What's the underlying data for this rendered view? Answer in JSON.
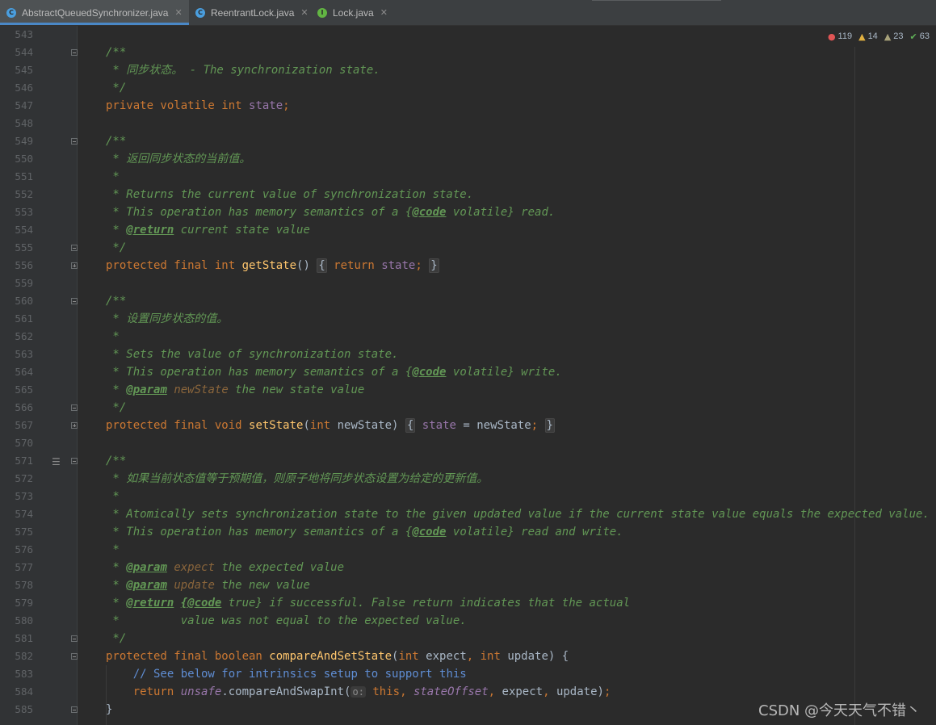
{
  "tabs": [
    {
      "label": "AbstractQueuedSynchronizer.java",
      "icon": "C",
      "icon_color": "#4a9ede",
      "active": true
    },
    {
      "label": "ReentrantLock.java",
      "icon": "C",
      "icon_color": "#4a9ede",
      "active": false
    },
    {
      "label": "Lock.java",
      "icon": "I",
      "icon_color": "#62b543",
      "active": false
    }
  ],
  "inspections": {
    "errors": "119",
    "warnings": "14",
    "weak_warnings": "23",
    "typos": "63",
    "colors": {
      "error": "#e05555",
      "warning": "#e0b040",
      "weak": "#a8a27a",
      "ok": "#5fb057"
    }
  },
  "watermark": "CSDN @今天天气不错丶",
  "lines": [
    {
      "n": "543",
      "tokens": []
    },
    {
      "n": "544",
      "fold": "open",
      "tokens": [
        [
          "doc",
          "/**"
        ]
      ]
    },
    {
      "n": "545",
      "tokens": [
        [
          "doc",
          " * 同步状态。 - The synchronization state."
        ]
      ]
    },
    {
      "n": "546",
      "tokens": [
        [
          "doc",
          " */"
        ]
      ]
    },
    {
      "n": "547",
      "tokens": [
        [
          "kw",
          "private volatile int "
        ],
        [
          "field",
          "state"
        ],
        [
          "kw",
          ";"
        ]
      ]
    },
    {
      "n": "548",
      "tokens": []
    },
    {
      "n": "549",
      "fold": "open",
      "tokens": [
        [
          "doc",
          "/**"
        ]
      ]
    },
    {
      "n": "550",
      "tokens": [
        [
          "doc",
          " * 返回同步状态的当前值。"
        ]
      ]
    },
    {
      "n": "551",
      "tokens": [
        [
          "doc",
          " *"
        ]
      ]
    },
    {
      "n": "552",
      "tokens": [
        [
          "doc",
          " * Returns the current value of synchronization state."
        ]
      ]
    },
    {
      "n": "553",
      "tokens": [
        [
          "doc",
          " * This operation has memory semantics of a "
        ],
        [
          "doc",
          "{"
        ],
        [
          "tag",
          "@code"
        ],
        [
          "doc",
          " volatile} read."
        ]
      ]
    },
    {
      "n": "554",
      "tokens": [
        [
          "doc",
          " * "
        ],
        [
          "tag",
          "@return"
        ],
        [
          "doc",
          " current state value"
        ]
      ]
    },
    {
      "n": "555",
      "fold": "open",
      "tokens": [
        [
          "doc",
          " */"
        ]
      ]
    },
    {
      "n": "556",
      "fold": "collapsed",
      "tokens": [
        [
          "kw",
          "protected final int "
        ],
        [
          "method",
          "getState"
        ],
        [
          "plain",
          "() "
        ],
        [
          "fold",
          "{"
        ],
        [
          "kw",
          " return "
        ],
        [
          "field",
          "state"
        ],
        [
          "kw",
          ";"
        ],
        [
          "plain",
          " "
        ],
        [
          "fold",
          "}"
        ]
      ]
    },
    {
      "n": "559",
      "tokens": []
    },
    {
      "n": "560",
      "fold": "open",
      "tokens": [
        [
          "doc",
          "/**"
        ]
      ]
    },
    {
      "n": "561",
      "tokens": [
        [
          "doc",
          " * 设置同步状态的值。"
        ]
      ]
    },
    {
      "n": "562",
      "tokens": [
        [
          "doc",
          " *"
        ]
      ]
    },
    {
      "n": "563",
      "tokens": [
        [
          "doc",
          " * Sets the value of synchronization state."
        ]
      ]
    },
    {
      "n": "564",
      "tokens": [
        [
          "doc",
          " * This operation has memory semantics of a "
        ],
        [
          "doc",
          "{"
        ],
        [
          "tag",
          "@code"
        ],
        [
          "doc",
          " volatile} write."
        ]
      ]
    },
    {
      "n": "565",
      "tokens": [
        [
          "doc",
          " * "
        ],
        [
          "tag",
          "@param"
        ],
        [
          "doc",
          " "
        ],
        [
          "param",
          "newState"
        ],
        [
          "doc",
          " the new state value"
        ]
      ]
    },
    {
      "n": "566",
      "fold": "open",
      "tokens": [
        [
          "doc",
          " */"
        ]
      ]
    },
    {
      "n": "567",
      "fold": "collapsed",
      "tokens": [
        [
          "kw",
          "protected final void "
        ],
        [
          "method",
          "setState"
        ],
        [
          "plain",
          "("
        ],
        [
          "kw",
          "int "
        ],
        [
          "plain",
          "newState) "
        ],
        [
          "fold",
          "{"
        ],
        [
          "plain",
          " "
        ],
        [
          "field",
          "state"
        ],
        [
          "plain",
          " = newState"
        ],
        [
          "kw",
          ";"
        ],
        [
          "plain",
          " "
        ],
        [
          "fold",
          "}"
        ]
      ]
    },
    {
      "n": "570",
      "tokens": []
    },
    {
      "n": "571",
      "fold": "open",
      "marker": true,
      "tokens": [
        [
          "doc",
          "/**"
        ]
      ]
    },
    {
      "n": "572",
      "tokens": [
        [
          "doc",
          " * 如果当前状态值等于预期值，则原子地将同步状态设置为给定的更新值。"
        ]
      ]
    },
    {
      "n": "573",
      "tokens": [
        [
          "doc",
          " *"
        ]
      ]
    },
    {
      "n": "574",
      "tokens": [
        [
          "doc",
          " * Atomically sets synchronization state to the given updated value if the current state value equals the expected value."
        ]
      ]
    },
    {
      "n": "575",
      "tokens": [
        [
          "doc",
          " * This operation has memory semantics of a "
        ],
        [
          "doc",
          "{"
        ],
        [
          "tag",
          "@code"
        ],
        [
          "doc",
          " volatile} read and write."
        ]
      ]
    },
    {
      "n": "576",
      "tokens": [
        [
          "doc",
          " *"
        ]
      ]
    },
    {
      "n": "577",
      "tokens": [
        [
          "doc",
          " * "
        ],
        [
          "tag",
          "@param"
        ],
        [
          "doc",
          " "
        ],
        [
          "param",
          "expect"
        ],
        [
          "doc",
          " the expected value"
        ]
      ]
    },
    {
      "n": "578",
      "tokens": [
        [
          "doc",
          " * "
        ],
        [
          "tag",
          "@param"
        ],
        [
          "doc",
          " "
        ],
        [
          "param",
          "update"
        ],
        [
          "doc",
          " the new value"
        ]
      ]
    },
    {
      "n": "579",
      "tokens": [
        [
          "doc",
          " * "
        ],
        [
          "tag",
          "@return"
        ],
        [
          "doc",
          " "
        ],
        [
          "tag",
          "{@code"
        ],
        [
          "doc",
          " true} if successful. False return indicates that the actual"
        ]
      ]
    },
    {
      "n": "580",
      "tokens": [
        [
          "doc",
          " *         value was not equal to the expected value."
        ]
      ]
    },
    {
      "n": "581",
      "fold": "open",
      "tokens": [
        [
          "doc",
          " */"
        ]
      ]
    },
    {
      "n": "582",
      "fold": "open",
      "tokens": [
        [
          "kw",
          "protected final boolean "
        ],
        [
          "method",
          "compareAndSetState"
        ],
        [
          "plain",
          "("
        ],
        [
          "kw",
          "int "
        ],
        [
          "plain",
          "expect"
        ],
        [
          "kw",
          ", int "
        ],
        [
          "plain",
          "update) {"
        ]
      ]
    },
    {
      "n": "583",
      "tokens": [
        [
          "plain",
          "    "
        ],
        [
          "cmt",
          "// See below for intrinsics setup to support this"
        ]
      ]
    },
    {
      "n": "584",
      "tokens": [
        [
          "plain",
          "    "
        ],
        [
          "kw",
          "return "
        ],
        [
          "sfield",
          "unsafe"
        ],
        [
          "plain",
          ".compareAndSwapInt("
        ],
        [
          "hint",
          "o:"
        ],
        [
          "plain",
          " "
        ],
        [
          "kw",
          "this, "
        ],
        [
          "sfield",
          "stateOffset"
        ],
        [
          "kw",
          ", "
        ],
        [
          "plain",
          "expect"
        ],
        [
          "kw",
          ", "
        ],
        [
          "plain",
          "update)"
        ],
        [
          "kw",
          ";"
        ]
      ]
    },
    {
      "n": "585",
      "fold": "open",
      "tokens": [
        [
          "plain",
          "}"
        ]
      ]
    }
  ]
}
